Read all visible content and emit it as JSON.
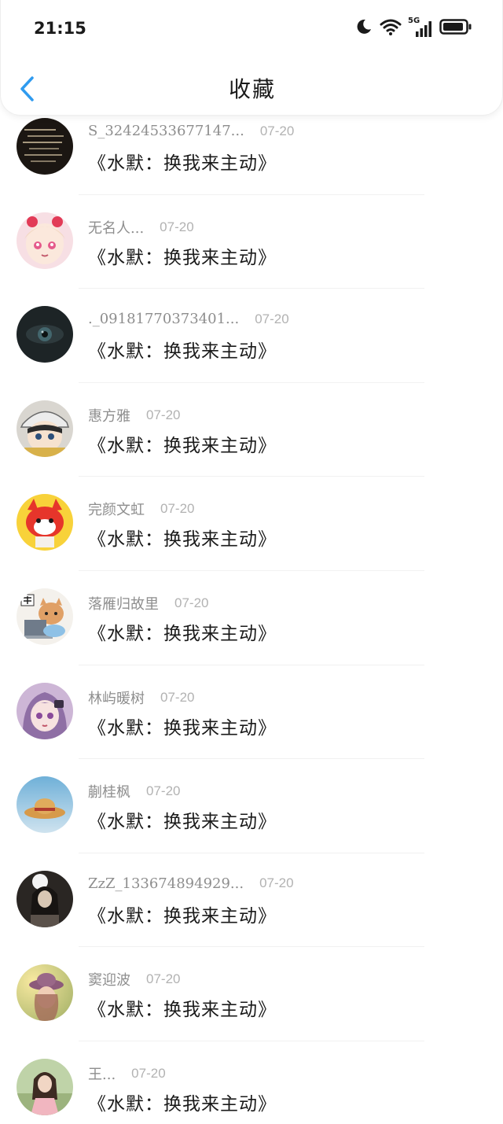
{
  "status_bar": {
    "time": "21:15",
    "network_label": "5G"
  },
  "header": {
    "title": "收藏"
  },
  "colors": {
    "accent": "#2f9bef",
    "text_primary": "#1a1a1a",
    "text_secondary": "#8e8e8e",
    "text_date": "#b2b2b2"
  },
  "favorites": [
    {
      "author": "S_32424533677147...",
      "date": "07-20",
      "title": "《水默：换我来主动》",
      "avatar": "dark-handwriting"
    },
    {
      "author": "无名人...",
      "date": "07-20",
      "title": "《水默：换我来主动》",
      "avatar": "anime-girl-pink"
    },
    {
      "author": "._09181770373401...",
      "date": "07-20",
      "title": "《水默：换我来主动》",
      "avatar": "dark-eye"
    },
    {
      "author": "惠方雅",
      "date": "07-20",
      "title": "《水默：换我来主动》",
      "avatar": "anime-boy-cap"
    },
    {
      "author": "完颜文虹",
      "date": "07-20",
      "title": "《水默：换我来主动》",
      "avatar": "red-fox-cartoon"
    },
    {
      "author": "落雁归故里",
      "date": "07-20",
      "title": "《水默：换我来主动》",
      "avatar": "cat-computer"
    },
    {
      "author": "林屿暖树",
      "date": "07-20",
      "title": "《水默：换我来主动》",
      "avatar": "anime-girl-purple"
    },
    {
      "author": "蒯桂枫",
      "date": "07-20",
      "title": "《水默：换我来主动》",
      "avatar": "straw-hat-sky"
    },
    {
      "author": "ZzZ_133674894929...",
      "date": "07-20",
      "title": "《水默：换我来主动》",
      "avatar": "girl-dark-photo"
    },
    {
      "author": "窦迎波",
      "date": "07-20",
      "title": "《水默：换我来主动》",
      "avatar": "girl-hat-sunset"
    },
    {
      "author": "王...",
      "date": "07-20",
      "title": "《水默：换我来主动》",
      "avatar": "girl-field"
    }
  ]
}
